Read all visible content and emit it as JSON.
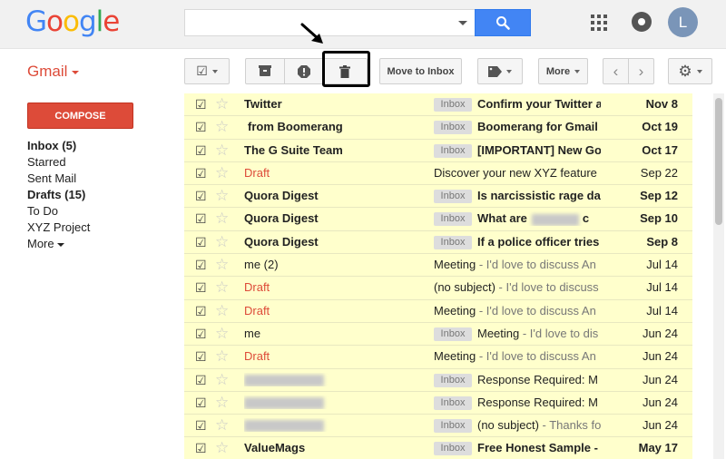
{
  "header": {
    "logo": [
      "G",
      "o",
      "o",
      "g",
      "l",
      "e"
    ],
    "logo_colors": [
      "#4285f4",
      "#ea4335",
      "#fbbc05",
      "#4285f4",
      "#34a853",
      "#ea4335"
    ],
    "search_value": "",
    "avatar_letter": "L"
  },
  "app_label": "Gmail",
  "toolbar": {
    "move_to_inbox": "Move to Inbox",
    "more": "More"
  },
  "sidebar": {
    "compose": "COMPOSE",
    "items": [
      {
        "label": "Inbox (5)",
        "bold": true
      },
      {
        "label": "Starred",
        "bold": false
      },
      {
        "label": "Sent Mail",
        "bold": false
      },
      {
        "label": "Drafts (15)",
        "bold": true
      },
      {
        "label": "To Do",
        "bold": false
      },
      {
        "label": "XYZ Project",
        "bold": false
      },
      {
        "label": "More",
        "bold": false
      }
    ]
  },
  "colors": {
    "accent_red": "#dd4b39",
    "search_blue": "#4285f4",
    "selected_row": "#ffffcc"
  },
  "emails": [
    {
      "sender": "Twitter",
      "sender_blur": false,
      "sender_style": "unread",
      "badge": "Inbox",
      "subject": "Confirm your Twitter a",
      "snippet": "",
      "unread": true,
      "date": "Nov 8"
    },
    {
      "sender": "from Boomerang",
      "sender_blur": true,
      "sender_style": "unread",
      "badge": "Inbox",
      "subject": "Boomerang for Gmail",
      "snippet": "",
      "unread": true,
      "date": "Oct 19"
    },
    {
      "sender": "The G Suite Team",
      "sender_blur": false,
      "sender_style": "unread",
      "badge": "Inbox",
      "subject": "[IMPORTANT] New Go",
      "snippet": "",
      "unread": true,
      "date": "Oct 17"
    },
    {
      "sender": "Draft",
      "sender_blur": false,
      "sender_style": "draft",
      "badge": "",
      "subject": "Discover your new XYZ feature",
      "snippet": "",
      "unread": false,
      "date": "Sep 22"
    },
    {
      "sender": "Quora Digest",
      "sender_blur": false,
      "sender_style": "unread",
      "badge": "Inbox",
      "subject": "Is narcissistic rage da",
      "snippet": "",
      "unread": true,
      "date": "Sep 12"
    },
    {
      "sender": "Quora Digest",
      "sender_blur": false,
      "sender_style": "unread",
      "badge": "Inbox",
      "subject": "What are",
      "snippet": "",
      "unread": true,
      "date": "Sep 10"
    },
    {
      "sender": "Quora Digest",
      "sender_blur": false,
      "sender_style": "unread",
      "badge": "Inbox",
      "subject": "If a police officer tries",
      "snippet": "",
      "unread": true,
      "date": "Sep 8"
    },
    {
      "sender": "me (2)",
      "sender_blur": false,
      "sender_style": "read",
      "badge": "",
      "subject": "Meeting",
      "snippet": " - I'd love to discuss An",
      "unread": false,
      "date": "Jul 14"
    },
    {
      "sender": "Draft",
      "sender_blur": false,
      "sender_style": "draft",
      "badge": "",
      "subject": "(no subject)",
      "snippet": " - I'd love to discuss",
      "unread": false,
      "date": "Jul 14"
    },
    {
      "sender": "Draft",
      "sender_blur": false,
      "sender_style": "draft",
      "badge": "",
      "subject": "Meeting",
      "snippet": " - I'd love to discuss An",
      "unread": false,
      "date": "Jul 14"
    },
    {
      "sender": "me",
      "sender_blur": false,
      "sender_style": "read",
      "badge": "Inbox",
      "subject": "Meeting",
      "snippet": " - I'd love to dis",
      "unread": false,
      "date": "Jun 24"
    },
    {
      "sender": "Draft",
      "sender_blur": false,
      "sender_style": "draft",
      "badge": "",
      "subject": "Meeting",
      "snippet": " - I'd love to discuss An",
      "unread": false,
      "date": "Jun 24"
    },
    {
      "sender": "",
      "sender_blur": true,
      "sender_style": "read",
      "badge": "Inbox",
      "subject": "Response Required: M",
      "snippet": "",
      "unread": false,
      "date": "Jun 24"
    },
    {
      "sender": "",
      "sender_blur": true,
      "sender_style": "read",
      "badge": "Inbox",
      "subject": "Response Required: M",
      "snippet": "",
      "unread": false,
      "date": "Jun 24"
    },
    {
      "sender": "",
      "sender_blur": true,
      "sender_style": "read",
      "badge": "Inbox",
      "subject": "(no subject)",
      "snippet": " - Thanks fo",
      "unread": false,
      "date": "Jun 24"
    },
    {
      "sender": "ValueMags",
      "sender_blur": false,
      "sender_style": "unread",
      "badge": "Inbox",
      "subject": "Free Honest Sample -",
      "snippet": "",
      "unread": true,
      "date": "May 17"
    }
  ]
}
